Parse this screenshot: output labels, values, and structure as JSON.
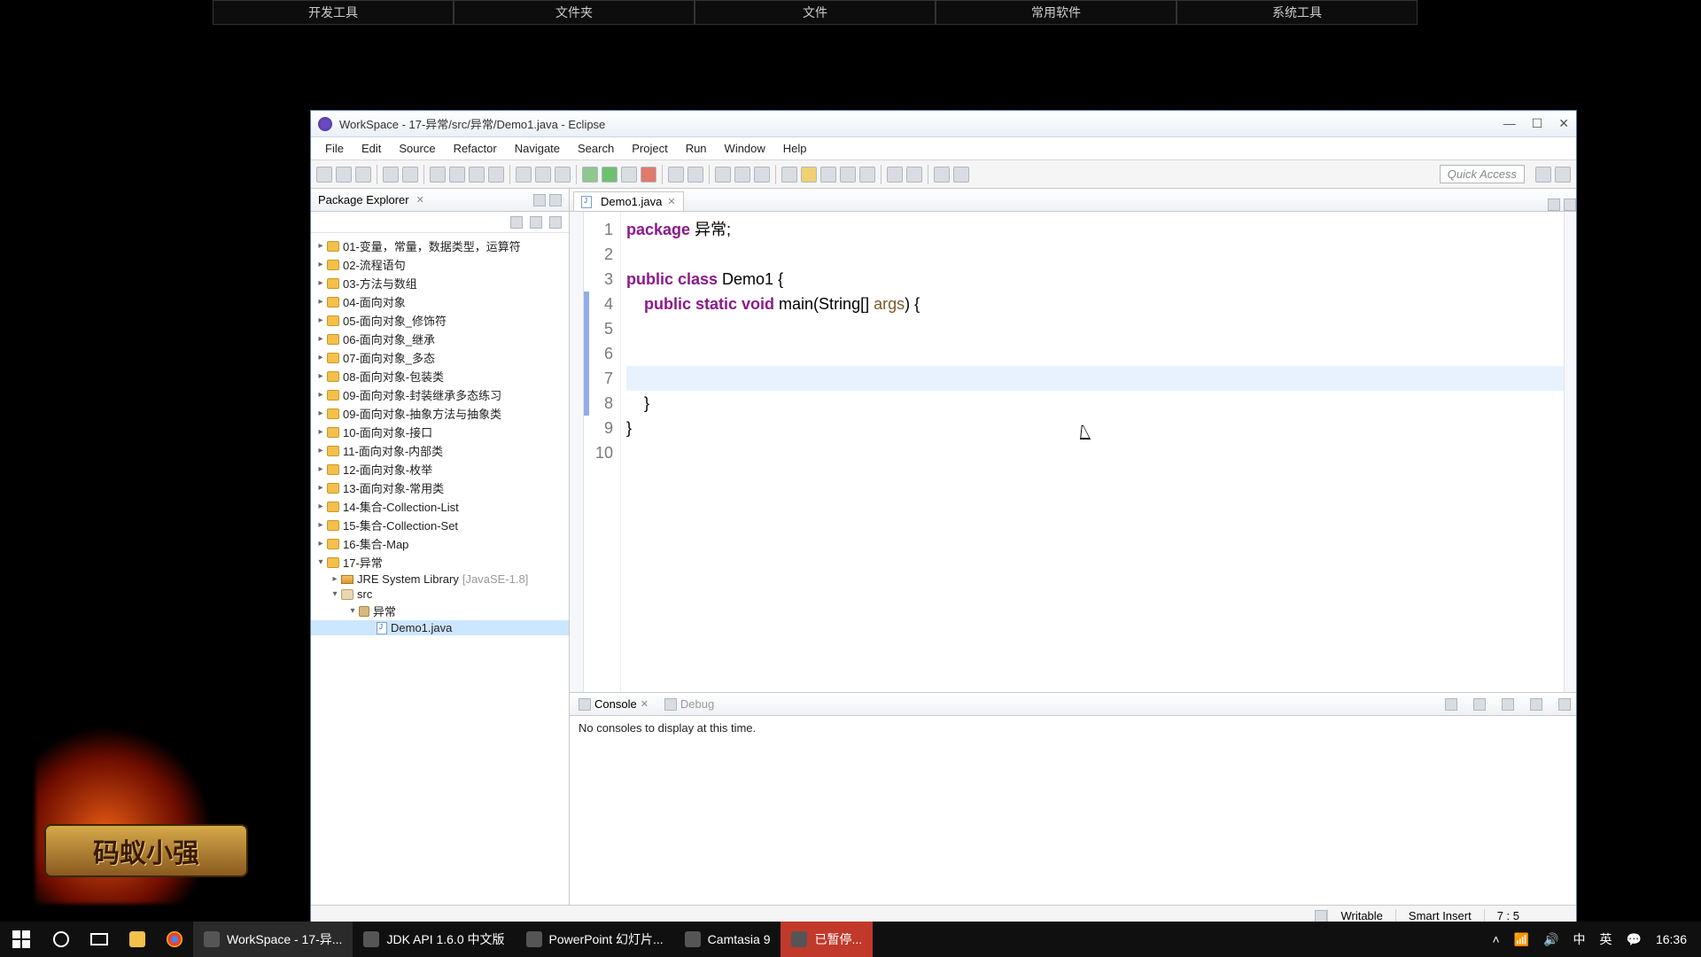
{
  "desk_tabs": [
    "开发工具",
    "文件夹",
    "文件",
    "常用软件",
    "系统工具"
  ],
  "logo_text": "码蚁小强",
  "eclipse": {
    "title": "WorkSpace - 17-异常/src/异常/Demo1.java - Eclipse",
    "menu": [
      "File",
      "Edit",
      "Source",
      "Refactor",
      "Navigate",
      "Search",
      "Project",
      "Run",
      "Window",
      "Help"
    ],
    "quick_access": "Quick Access",
    "package_explorer": {
      "title": "Package Explorer",
      "projects": [
        "01-变量，常量，数据类型，运算符",
        "02-流程语句",
        "03-方法与数组",
        "04-面向对象",
        "05-面向对象_修饰符",
        "06-面向对象_继承",
        "07-面向对象_多态",
        "08-面向对象-包装类",
        "09-面向对象-封装继承多态练习",
        "09-面向对象-抽象方法与抽象类",
        "10-面向对象-接口",
        "11-面向对象-内部类",
        "12-面向对象-枚举",
        "13-面向对象-常用类",
        "14-集合-Collection-List",
        "15-集合-Collection-Set",
        "16-集合-Map"
      ],
      "expanded_project": "17-异常",
      "jre_label": "JRE System Library",
      "jre_version": "[JavaSE-1.8]",
      "src_label": "src",
      "pkg_label": "异常",
      "file_label": "Demo1.java"
    },
    "editor": {
      "tab_label": "Demo1.java",
      "lines": [
        {
          "n": "1",
          "segs": [
            {
              "t": "package ",
              "c": "kw"
            },
            {
              "t": "异常;",
              "c": ""
            }
          ]
        },
        {
          "n": "2",
          "segs": [
            {
              "t": "",
              "c": ""
            }
          ]
        },
        {
          "n": "3",
          "segs": [
            {
              "t": "public class ",
              "c": "kw"
            },
            {
              "t": "Demo1 {",
              "c": ""
            }
          ]
        },
        {
          "n": "4",
          "segs": [
            {
              "t": "    ",
              "c": ""
            },
            {
              "t": "public static void ",
              "c": "kw"
            },
            {
              "t": "main(String[] ",
              "c": ""
            },
            {
              "t": "args",
              "c": "args"
            },
            {
              "t": ") {",
              "c": ""
            }
          ]
        },
        {
          "n": "5",
          "segs": [
            {
              "t": "",
              "c": ""
            }
          ]
        },
        {
          "n": "6",
          "segs": [
            {
              "t": "",
              "c": ""
            }
          ]
        },
        {
          "n": "7",
          "segs": [
            {
              "t": "        ",
              "c": ""
            }
          ],
          "current": true
        },
        {
          "n": "8",
          "segs": [
            {
              "t": "    }",
              "c": ""
            }
          ]
        },
        {
          "n": "9",
          "segs": [
            {
              "t": "}",
              "c": ""
            }
          ]
        },
        {
          "n": "10",
          "segs": [
            {
              "t": "",
              "c": ""
            }
          ]
        }
      ]
    },
    "console": {
      "tab_console": "Console",
      "tab_debug": "Debug",
      "message": "No consoles to display at this time."
    },
    "status": {
      "writable": "Writable",
      "insert": "Smart Insert",
      "pos": "7 : 5"
    }
  },
  "taskbar": {
    "items": [
      {
        "label": "WorkSpace - 17-异...",
        "active": true
      },
      {
        "label": "JDK API 1.6.0 中文版"
      },
      {
        "label": "PowerPoint 幻灯片..."
      },
      {
        "label": "Camtasia 9"
      },
      {
        "label": "已暂停...",
        "hot": true
      }
    ],
    "ime_lang": "中",
    "ime_kbd": "英",
    "time": "16:36",
    "date": ""
  }
}
